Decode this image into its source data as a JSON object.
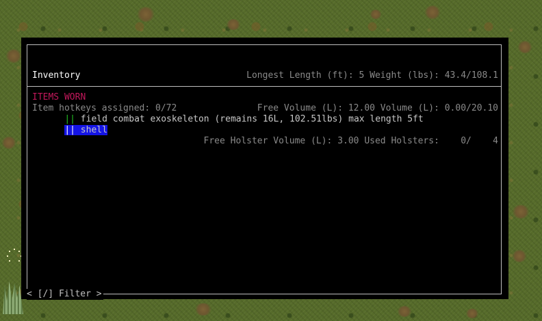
{
  "header": {
    "title": "Inventory",
    "hotkeys": "Item hotkeys assigned: 0/72",
    "length_weight": "Longest Length (ft): 5 Weight (lbs): 43.4/108.1",
    "volume": "Free Volume (L): 12.00 Volume (L): 0.00/20.10",
    "holster": "Free Holster Volume (L): 3.00 Used Holsters:    0/    4"
  },
  "section": {
    "label": "ITEMS WORN",
    "items": [
      {
        "mark": "||",
        "name": "field combat exoskeleton (remains 16L, 102.51lbs) max length 5ft",
        "selected": false
      },
      {
        "mark": "||",
        "name": "shell",
        "selected": true
      }
    ]
  },
  "footer": {
    "filter": "< [/] Filter >"
  },
  "colors": {
    "section_header": "#c2185b",
    "item_mark": "#22c322",
    "selection": "#1414e6",
    "frame": "#c0c0c0"
  }
}
